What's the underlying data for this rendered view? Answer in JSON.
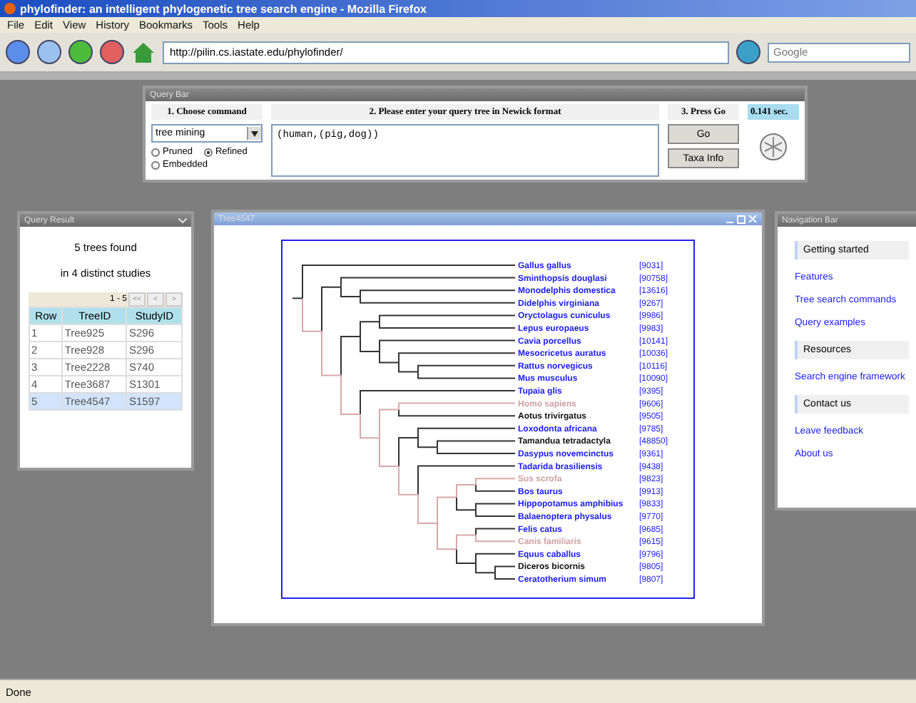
{
  "window": {
    "title": "phylofinder: an intelligent phylogenetic tree search engine - Mozilla Firefox"
  },
  "menu": [
    "File",
    "Edit",
    "View",
    "History",
    "Bookmarks",
    "Tools",
    "Help"
  ],
  "address": "http://pilin.cs.iastate.edu/phylofinder/",
  "search": {
    "placeholder": "Google"
  },
  "query_bar": {
    "title": "Query Bar",
    "step1": "1. Choose command",
    "command": "tree mining",
    "options": [
      {
        "label": "Pruned",
        "selected": false
      },
      {
        "label": "Refined",
        "selected": true
      },
      {
        "label": "Embedded",
        "selected": false
      }
    ],
    "step2": "2. Please enter your query tree in Newick format",
    "query": "(human,(pig,dog))",
    "step3": "3. Press Go",
    "time": "0.141 sec.",
    "buttons": [
      "Go",
      "Taxa Info"
    ]
  },
  "query_result": {
    "title": "Query Result",
    "summary": [
      "5 trees found",
      "in 4 distinct studies"
    ],
    "range": "1 - 5",
    "pager": [
      "<<",
      "<",
      ">"
    ],
    "columns": [
      "Row",
      "TreeID",
      "StudyID"
    ],
    "rows": [
      {
        "cells": [
          "1",
          "Tree925",
          "S296"
        ],
        "selected": false
      },
      {
        "cells": [
          "2",
          "Tree928",
          "S296"
        ],
        "selected": false
      },
      {
        "cells": [
          "3",
          "Tree2228",
          "S740"
        ],
        "selected": false
      },
      {
        "cells": [
          "4",
          "Tree3687",
          "S1301"
        ],
        "selected": false
      },
      {
        "cells": [
          "5",
          "Tree4547",
          "S1597"
        ],
        "selected": true
      }
    ]
  },
  "tree_window": {
    "title": "Tree4547",
    "tree": {
      "children": [
        {
          "name": "Gallus gallus",
          "id": "[9031]",
          "kind": "link"
        },
        {
          "children": [
            {
              "children": [
                {
                  "name": "Sminthopsis douglasi",
                  "id": "[90758]",
                  "kind": "link"
                },
                {
                  "children": [
                    {
                      "name": "Monodelphis domestica",
                      "id": "[13616]",
                      "kind": "link"
                    },
                    {
                      "name": "Didelphis virginiana",
                      "id": "[9267]",
                      "kind": "link"
                    }
                  ]
                }
              ]
            },
            {
              "children": [
                {
                  "children": [
                    {
                      "children": [
                        {
                          "name": "Oryctolagus cuniculus",
                          "id": "[9986]",
                          "kind": "link"
                        },
                        {
                          "name": "Lepus europaeus",
                          "id": "[9983]",
                          "kind": "link"
                        }
                      ]
                    },
                    {
                      "children": [
                        {
                          "name": "Cavia porcellus",
                          "id": "[10141]",
                          "kind": "link"
                        },
                        {
                          "children": [
                            {
                              "name": "Mesocricetus auratus",
                              "id": "[10036]",
                              "kind": "link"
                            },
                            {
                              "children": [
                                {
                                  "name": "Rattus norvegicus",
                                  "id": "[10116]",
                                  "kind": "link"
                                },
                                {
                                  "name": "Mus musculus",
                                  "id": "[10090]",
                                  "kind": "link"
                                }
                              ]
                            }
                          ]
                        }
                      ]
                    }
                  ]
                },
                {
                  "children": [
                    {
                      "name": "Tupaia glis",
                      "id": "[9395]",
                      "kind": "link"
                    },
                    {
                      "children": [
                        {
                          "children": [
                            {
                              "name": "Homo sapiens",
                              "id": "[9606]",
                              "kind": "query"
                            },
                            {
                              "name": "Aotus trivirgatus",
                              "id": "[9505]",
                              "kind": "plain"
                            }
                          ]
                        },
                        {
                          "children": [
                            {
                              "children": [
                                {
                                  "name": "Loxodonta africana",
                                  "id": "[9785]",
                                  "kind": "link"
                                },
                                {
                                  "children": [
                                    {
                                      "name": "Tamandua tetradactyla",
                                      "id": "[48850]",
                                      "kind": "plain"
                                    },
                                    {
                                      "name": "Dasypus novemcinctus",
                                      "id": "[9361]",
                                      "kind": "link"
                                    }
                                  ]
                                }
                              ]
                            },
                            {
                              "children": [
                                {
                                  "name": "Tadarida brasiliensis",
                                  "id": "[9438]",
                                  "kind": "link"
                                },
                                {
                                  "children": [
                                    {
                                      "children": [
                                        {
                                          "children": [
                                            {
                                              "name": "Sus scrofa",
                                              "id": "[9823]",
                                              "kind": "query"
                                            },
                                            {
                                              "name": "Bos taurus",
                                              "id": "[9913]",
                                              "kind": "link"
                                            }
                                          ]
                                        },
                                        {
                                          "children": [
                                            {
                                              "name": "Hippopotamus amphibius",
                                              "id": "[9833]",
                                              "kind": "link"
                                            },
                                            {
                                              "name": "Balaenoptera physalus",
                                              "id": "[9770]",
                                              "kind": "link"
                                            }
                                          ]
                                        }
                                      ]
                                    },
                                    {
                                      "children": [
                                        {
                                          "children": [
                                            {
                                              "name": "Felis catus",
                                              "id": "[9685]",
                                              "kind": "link"
                                            },
                                            {
                                              "name": "Canis familiaris",
                                              "id": "[9615]",
                                              "kind": "query"
                                            }
                                          ]
                                        },
                                        {
                                          "children": [
                                            {
                                              "name": "Equus caballus",
                                              "id": "[9796]",
                                              "kind": "link"
                                            },
                                            {
                                              "children": [
                                                {
                                                  "name": "Diceros bicornis",
                                                  "id": "[9805]",
                                                  "kind": "plain"
                                                },
                                                {
                                                  "name": "Ceratotherium simum",
                                                  "id": "[9807]",
                                                  "kind": "link"
                                                }
                                              ]
                                            }
                                          ]
                                        }
                                      ]
                                    }
                                  ]
                                }
                              ]
                            }
                          ]
                        }
                      ]
                    }
                  ]
                }
              ]
            }
          ]
        }
      ]
    }
  },
  "navigation": {
    "title": "Navigation Bar",
    "sections": [
      {
        "heading": "Getting started",
        "links": [
          "Features",
          "Tree search commands",
          "Query examples"
        ]
      },
      {
        "heading": "Resources",
        "links": [
          "Search engine framework"
        ]
      },
      {
        "heading": "Contact us",
        "links": [
          "Leave feedback",
          "About us"
        ]
      }
    ]
  },
  "status_bar": "Done"
}
